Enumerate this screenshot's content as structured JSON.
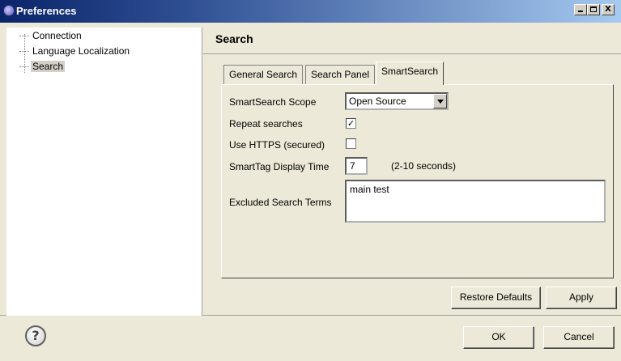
{
  "window": {
    "title": "Preferences",
    "controls": {
      "minimize": "_",
      "maximize": "□",
      "close": "X"
    }
  },
  "tree": {
    "items": [
      {
        "label": "Connection",
        "selected": false
      },
      {
        "label": "Language Localization",
        "selected": false
      },
      {
        "label": "Search",
        "selected": true
      }
    ]
  },
  "panel": {
    "title": "Search",
    "tabs": [
      {
        "label": "General Search",
        "active": false
      },
      {
        "label": "Search Panel",
        "active": false
      },
      {
        "label": "SmartSearch",
        "active": true
      }
    ],
    "fields": {
      "scope_label": "SmartSearch Scope",
      "scope_value": "Open Source",
      "repeat_label": "Repeat searches",
      "repeat_checked": true,
      "https_label": "Use HTTPS (secured)",
      "https_checked": false,
      "display_time_label": "SmartTag Display Time",
      "display_time_value": "7",
      "display_time_hint": "(2-10 seconds)",
      "excluded_label": "Excluded Search Terms",
      "excluded_value": "main test"
    },
    "buttons": {
      "restore_defaults": "Restore Defaults",
      "apply": "Apply"
    }
  },
  "footer": {
    "help_glyph": "?",
    "ok": "OK",
    "cancel": "Cancel"
  },
  "colors": {
    "titlebar_start": "#0a246a",
    "titlebar_end": "#a6caf0",
    "background": "#ece9d8"
  }
}
